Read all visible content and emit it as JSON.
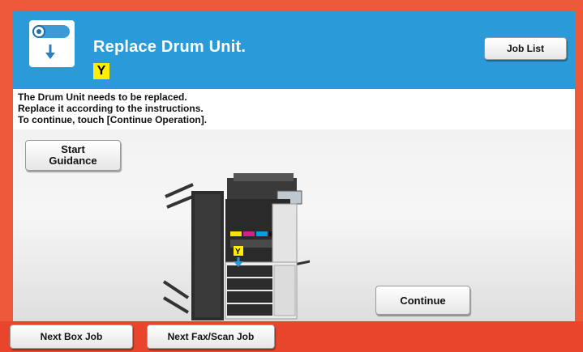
{
  "header": {
    "title": "Replace Drum Unit.",
    "color_badge": "Y",
    "job_list_label": "Job List",
    "icon": "drum-unit-icon"
  },
  "message": {
    "lines": [
      "The Drum Unit needs to be replaced.",
      "Replace it according to the instructions.",
      "To continue, touch [Continue Operation]."
    ]
  },
  "content": {
    "start_guidance_label": "Start\nGuidance",
    "continue_label": "Continue",
    "printer_badge": "Y"
  },
  "footer": {
    "next_box_job_label": "Next Box Job",
    "next_fax_scan_job_label": "Next Fax/Scan Job"
  },
  "colors": {
    "header_blue": "#2a9ad8",
    "frame_red": "#e8452c",
    "yellow": "#ffee00"
  }
}
